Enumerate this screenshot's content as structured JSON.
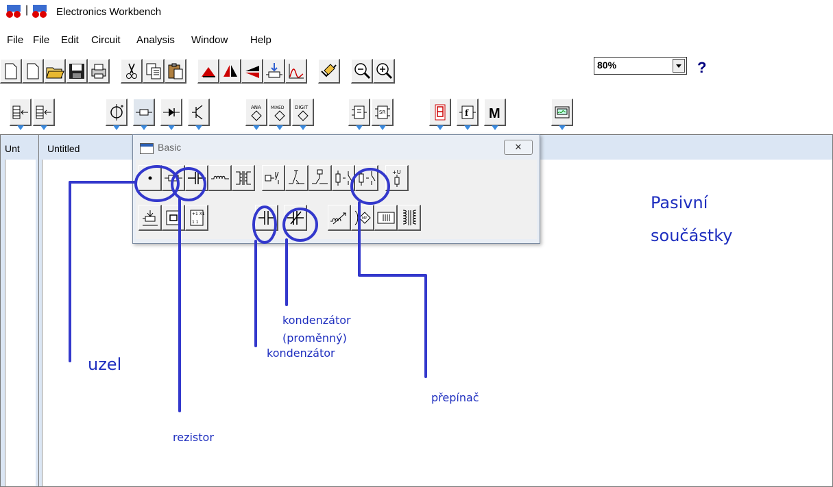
{
  "window": {
    "title": "Electronics Workbench"
  },
  "menu": [
    "File",
    "File",
    "Edit",
    "Circuit",
    "Analysis",
    "Window",
    "Help"
  ],
  "toolbar": {
    "zoom_value": "80%",
    "help_label": "?",
    "mixed_label": "MIXED",
    "ana_label": "ANA",
    "digit_label": "DIGIT",
    "m_label": "M"
  },
  "documents": {
    "back_title": "Unt",
    "front_title": "Untitled"
  },
  "palette": {
    "title": "Basic",
    "close_label": "✕"
  },
  "annotations": {
    "uzel": "uzel",
    "rezistor": "rezistor",
    "kondenzator": "kondenzátor",
    "kondenzator_promenny_1": "kondenzátor",
    "kondenzator_promenny_2": "(proměnný)",
    "prepinac": "přepínač",
    "pasivni_1": "Pasivní",
    "pasivni_2": "součástky"
  },
  "colors": {
    "annotation": "#1f2fbf",
    "accent_arrow": "#3b8be0"
  }
}
